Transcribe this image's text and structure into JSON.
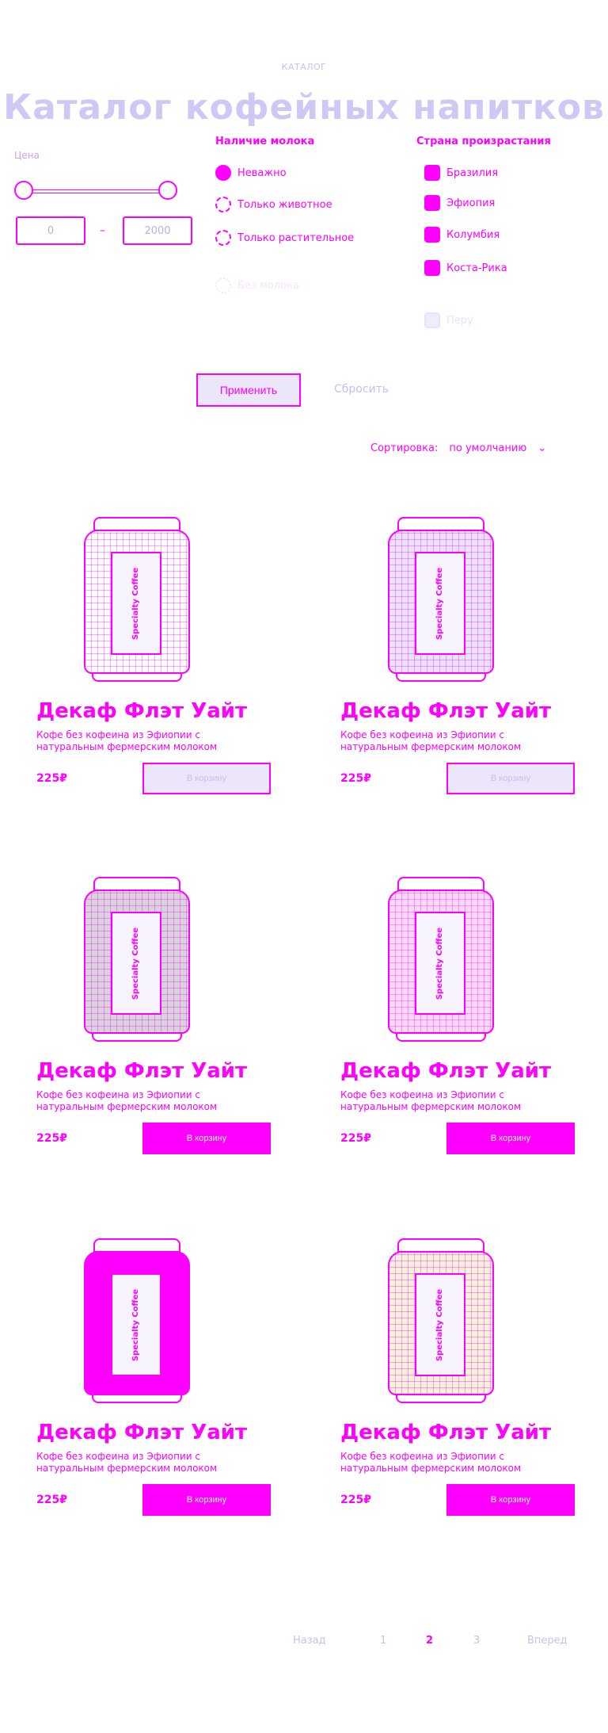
{
  "breadcrumb": "КАТАЛОГ",
  "title": "Каталог кофейных напитков",
  "filters": {
    "price": {
      "label": "Цена",
      "min_placeholder": "0",
      "max_placeholder": "2000"
    },
    "milk": {
      "title": "Наличие молока",
      "options": [
        "Неважно",
        "Только животное",
        "Только растительное",
        "Без молока"
      ],
      "selected": 0
    },
    "country": {
      "title": "Страна произрастания",
      "options": [
        "Бразилия",
        "Эфиопия",
        "Колумбия",
        "Коста-Рика",
        "Перу"
      ]
    },
    "apply_label": "Применить",
    "reset_label": "Сбросить"
  },
  "sort": {
    "label": "Сортировка:",
    "value": "по умолчанию"
  },
  "products": [
    {
      "name": "Декаф Флэт Уайт",
      "desc": "Кофе без кофеина из Эфиопии с натуральным фермерским молоком",
      "price": "225₽",
      "button": "В корзину",
      "can_text": "Specialty Coffee"
    },
    {
      "name": "Декаф Флэт Уайт",
      "desc": "Кофе без кофеина из Эфиопии с натуральным фермерским молоком",
      "price": "225₽",
      "button": "В корзину",
      "can_text": "Specialty Coffee"
    },
    {
      "name": "Декаф Флэт Уайт",
      "desc": "Кофе без кофеина из Эфиопии с натуральным фермерским молоком",
      "price": "225₽",
      "button": "В корзину",
      "can_text": "Specialty Coffee"
    },
    {
      "name": "Декаф Флэт Уайт",
      "desc": "Кофе без кофеина из Эфиопии с натуральным фермерским молоком",
      "price": "225₽",
      "button": "В корзину",
      "can_text": "Specialty Coffee"
    },
    {
      "name": "Декаф Флэт Уайт",
      "desc": "Кофе без кофеина из Эфиопии с натуральным фермерским молоком",
      "price": "225₽",
      "button": "В корзину",
      "can_text": "Specialty Coffee"
    },
    {
      "name": "Декаф Флэт Уайт",
      "desc": "Кофе без кофеина из Эфиопии с натуральным фермерским молоком",
      "price": "225₽",
      "button": "В корзину",
      "can_text": "Specialty Coffee"
    }
  ],
  "pagination": {
    "prev": "Назад",
    "pages": [
      "1",
      "2",
      "3"
    ],
    "current": "2",
    "next": "Вперед"
  },
  "colors": {
    "accent": "#ff00ff",
    "muted": "#c8bff0",
    "light_fill": "#ece6fb"
  },
  "icons": {
    "sort": "chevron-down-icon",
    "cart": "cart-icon"
  }
}
